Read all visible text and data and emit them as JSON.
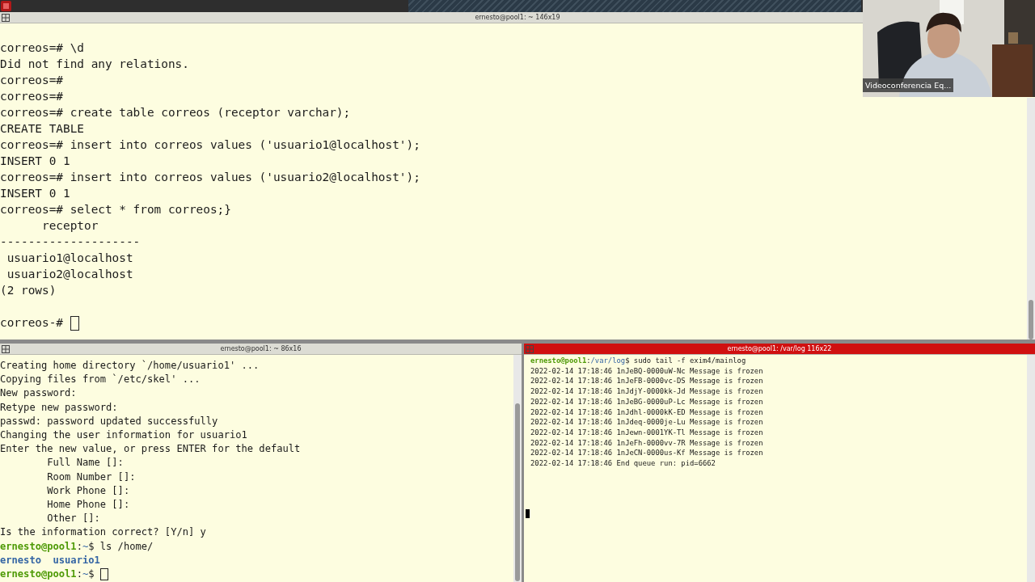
{
  "video_tile": {
    "kind": "picture",
    "participant": "Videoconferencia Eq..."
  },
  "terminals": [
    {
      "title": "ernesto@pool1: ~ 146x19",
      "focused": false,
      "cursor": true,
      "lines": [
        {
          "text": "correos=# \\d"
        },
        {
          "text": "Did not find any relations."
        },
        {
          "text": "correos=#"
        },
        {
          "text": "correos=#"
        },
        {
          "text": "correos=# create table correos (receptor varchar);"
        },
        {
          "text": "CREATE TABLE"
        },
        {
          "text": "correos=# insert into correos values ('usuario1@localhost');"
        },
        {
          "text": "INSERT 0 1"
        },
        {
          "text": "correos=# insert into correos values ('usuario2@localhost');"
        },
        {
          "text": "INSERT 0 1"
        },
        {
          "text": "correos=# select * from correos;}"
        },
        {
          "text": "      receptor"
        },
        {
          "text": "--------------------"
        },
        {
          "text": " usuario1@localhost"
        },
        {
          "text": " usuario2@localhost"
        },
        {
          "text": "(2 rows)"
        },
        {
          "text": "correos-# ",
          "gap_before": true
        }
      ]
    },
    {
      "title": "ernesto@pool1: ~ 86x16",
      "focused": false,
      "cursor": true,
      "lines": [
        {
          "text": "Creating home directory `/home/usuario1' ..."
        },
        {
          "text": "Copying files from `/etc/skel' ..."
        },
        {
          "text": "New password:"
        },
        {
          "text": "Retype new password:"
        },
        {
          "text": "passwd: password updated successfully"
        },
        {
          "text": "Changing the user information for usuario1"
        },
        {
          "text": "Enter the new value, or press ENTER for the default"
        },
        {
          "text": "        Full Name []:"
        },
        {
          "text": "        Room Number []:"
        },
        {
          "text": "        Work Phone []:"
        },
        {
          "text": "        Home Phone []:"
        },
        {
          "text": "        Other []:"
        },
        {
          "text": "Is the information correct? [Y/n] y"
        },
        {
          "segments": [
            {
              "kind": "user",
              "text": "ernesto@pool1"
            },
            {
              "kind": "plain",
              "text": ":"
            },
            {
              "kind": "path",
              "text": "~"
            },
            {
              "kind": "plain",
              "text": "$ ls /home/"
            }
          ]
        },
        {
          "segments": [
            {
              "kind": "dir",
              "text": "ernesto  usuario1"
            }
          ]
        },
        {
          "segments": [
            {
              "kind": "user",
              "text": "ernesto@pool1"
            },
            {
              "kind": "plain",
              "text": ":"
            },
            {
              "kind": "path",
              "text": "~"
            },
            {
              "kind": "plain",
              "text": "$ "
            }
          ]
        }
      ]
    },
    {
      "title": "ernesto@pool1: /var/log 116x22",
      "focused": true,
      "cursor": true,
      "lines": [
        {
          "segments": [
            {
              "kind": "user",
              "text": "ernesto@pool1"
            },
            {
              "kind": "plain",
              "text": ":"
            },
            {
              "kind": "path",
              "text": "/var/log"
            },
            {
              "kind": "plain",
              "text": "$ sudo tail -f exim4/mainlog"
            }
          ]
        },
        {
          "text": "2022-02-14 17:18:46 1nJeBQ-0000uW-Nc Message is frozen"
        },
        {
          "text": "2022-02-14 17:18:46 1nJeFB-0000vc-DS Message is frozen"
        },
        {
          "text": "2022-02-14 17:18:46 1nJdjY-0000kk-Jd Message is frozen"
        },
        {
          "text": "2022-02-14 17:18:46 1nJeBG-0000uP-Lc Message is frozen"
        },
        {
          "text": "2022-02-14 17:18:46 1nJdhl-0000kK-ED Message is frozen"
        },
        {
          "text": "2022-02-14 17:18:46 1nJdeq-0000je-Lu Message is frozen"
        },
        {
          "text": "2022-02-14 17:18:46 1nJewn-0001YK-Tl Message is frozen"
        },
        {
          "text": "2022-02-14 17:18:46 1nJeFh-0000vv-7R Message is frozen"
        },
        {
          "text": "2022-02-14 17:18:46 1nJeCN-0000us-Kf Message is frozen"
        },
        {
          "text": "2022-02-14 17:18:46 End queue run: pid=6662"
        }
      ]
    }
  ]
}
